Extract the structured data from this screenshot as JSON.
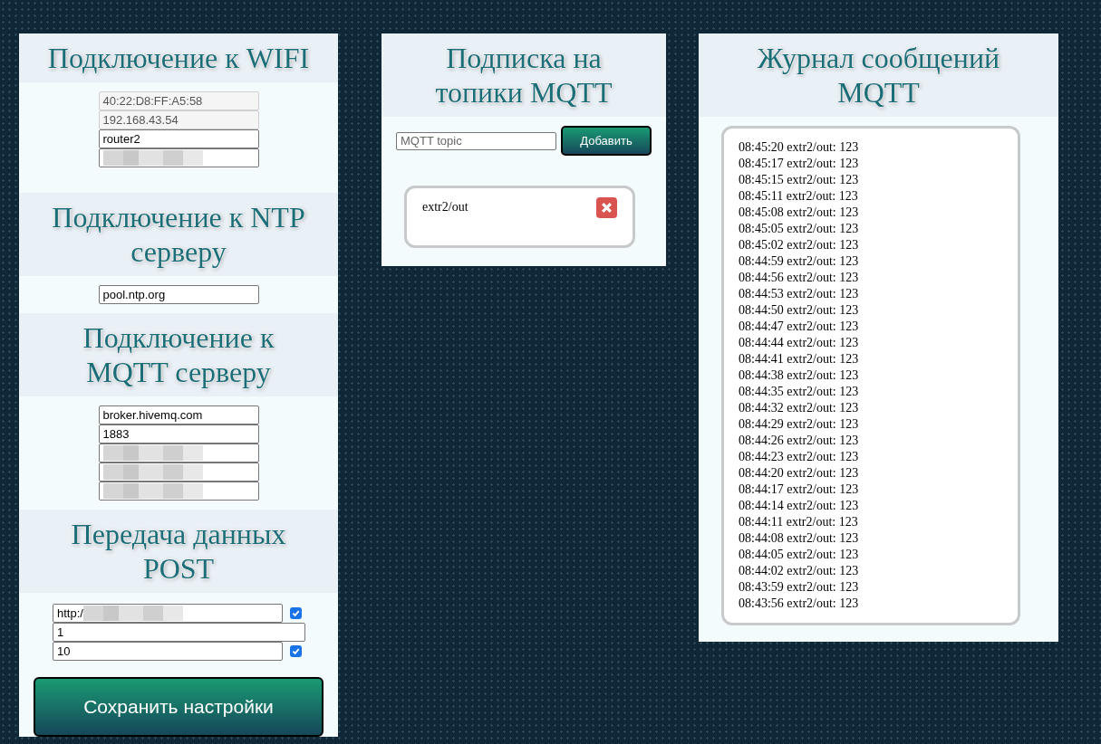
{
  "wifi": {
    "title": "Подключение к WIFI",
    "fields": [
      {
        "value": "40:22:D8:FF:A5:58",
        "readonly": true,
        "redacted": false
      },
      {
        "value": "192.168.43.54",
        "readonly": true,
        "redacted": false
      },
      {
        "value": "router2",
        "readonly": false,
        "redacted": false
      },
      {
        "readonly": false,
        "redacted": true
      }
    ]
  },
  "ntp": {
    "title": "Подключение к NTP серверу",
    "fields": [
      {
        "value": "pool.ntp.org",
        "readonly": false,
        "redacted": false
      }
    ]
  },
  "mqtt": {
    "title": "Подключение к MQTT серверу",
    "fields": [
      {
        "value": "broker.hivemq.com",
        "readonly": false,
        "redacted": false
      },
      {
        "value": "1883",
        "readonly": false,
        "redacted": false
      },
      {
        "readonly": false,
        "redacted": true
      },
      {
        "readonly": false,
        "redacted": true
      },
      {
        "readonly": false,
        "redacted": true
      }
    ]
  },
  "post": {
    "title": "Передача данных POST",
    "fields": [
      {
        "kind": "checkbox_field",
        "value": "http:/",
        "readonly": false,
        "redacted": true,
        "checked": true
      },
      {
        "kind": "field",
        "value": "1",
        "readonly": false,
        "redacted": false
      },
      {
        "kind": "checkbox_field",
        "value": "10",
        "readonly": false,
        "redacted": false,
        "checked": true
      }
    ],
    "save_button": "Сохранить настройки"
  },
  "subscriptions": {
    "title": "Подписка на топики MQTT",
    "topic_field": {
      "placeholder": "MQTT topic"
    },
    "add_button": "Добавить",
    "topics": [
      "extr2/out"
    ]
  },
  "log": {
    "title": "Журнал сообщений MQTT",
    "entries": [
      "08:45:20 extr2/out: 123",
      "08:45:17 extr2/out: 123",
      "08:45:15 extr2/out: 123",
      "08:45:11 extr2/out: 123",
      "08:45:08 extr2/out: 123",
      "08:45:05 extr2/out: 123",
      "08:45:02 extr2/out: 123",
      "08:44:59 extr2/out: 123",
      "08:44:56 extr2/out: 123",
      "08:44:53 extr2/out: 123",
      "08:44:50 extr2/out: 123",
      "08:44:47 extr2/out: 123",
      "08:44:44 extr2/out: 123",
      "08:44:41 extr2/out: 123",
      "08:44:38 extr2/out: 123",
      "08:44:35 extr2/out: 123",
      "08:44:32 extr2/out: 123",
      "08:44:29 extr2/out: 123",
      "08:44:26 extr2/out: 123",
      "08:44:23 extr2/out: 123",
      "08:44:20 extr2/out: 123",
      "08:44:17 extr2/out: 123",
      "08:44:14 extr2/out: 123",
      "08:44:11 extr2/out: 123",
      "08:44:08 extr2/out: 123",
      "08:44:05 extr2/out: 123",
      "08:44:02 extr2/out: 123",
      "08:43:59 extr2/out: 123",
      "08:43:56 extr2/out: 123"
    ]
  }
}
